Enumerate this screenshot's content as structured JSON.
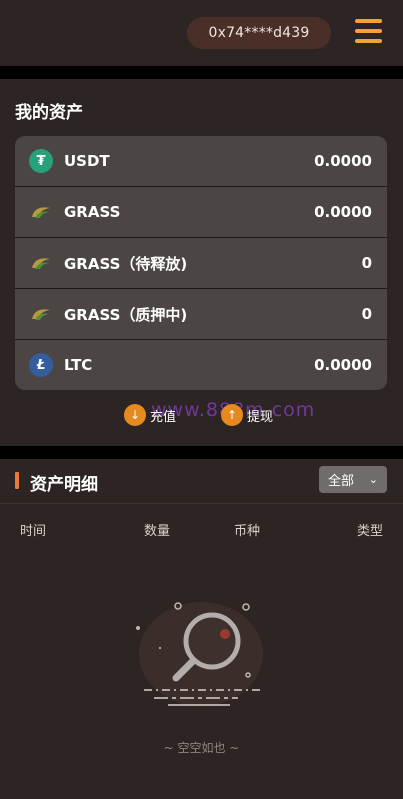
{
  "header": {
    "wallet_address": "0x74****d439",
    "menu_icon": "hamburger-menu-icon",
    "accent": "#f3a23a"
  },
  "assets": {
    "title": "我的资产",
    "rows": [
      {
        "name": "USDT",
        "amount": "0.0000",
        "icon": "usdt-icon",
        "color": "#26a17b"
      },
      {
        "name": "GRASS",
        "amount": "0.0000",
        "icon": "grass-icon",
        "color": "#8a7a3a"
      },
      {
        "name": "GRASS（待释放)",
        "amount": "0",
        "icon": "grass-icon",
        "color": "#8a7a3a"
      },
      {
        "name": "GRASS（质押中)",
        "amount": "0",
        "icon": "grass-icon",
        "color": "#8a7a3a"
      },
      {
        "name": "LTC",
        "amount": "0.0000",
        "icon": "litecoin-icon",
        "color": "#345d9d"
      }
    ],
    "deposit_label": "充值",
    "withdraw_label": "提现",
    "watermark": "www.888m.com"
  },
  "detail": {
    "title": "资产明细",
    "filter_value": "全部",
    "columns": [
      "时间",
      "数量",
      "币种",
      "类型"
    ],
    "empty_text": "~ 空空如也 ~"
  }
}
